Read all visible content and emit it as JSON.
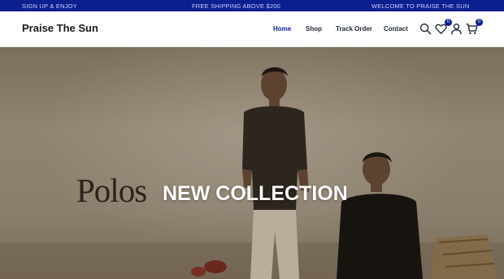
{
  "announcement_bar": {
    "messages": [
      "SIGN UP & ENJOY",
      "FREE SHIPPING ABOVE $200",
      "WELCOME TO PRAISE THE SUN"
    ]
  },
  "header": {
    "logo": "Praise The Sun",
    "nav": [
      {
        "label": "Home",
        "active": true
      },
      {
        "label": "Shop",
        "active": false
      },
      {
        "label": "Track Order",
        "active": false
      },
      {
        "label": "Contact",
        "active": false
      }
    ],
    "icons": {
      "search": "search-icon",
      "wishlist": "heart-icon",
      "account": "user-icon",
      "cart": "cart-icon"
    },
    "wishlist_count": "0",
    "cart_count": "0"
  },
  "hero": {
    "brand_text": "Polos",
    "title": "NEW COLLECTION"
  },
  "colors": {
    "accent": "#0c1f8f",
    "text_dark": "#1f2733",
    "white": "#ffffff"
  }
}
